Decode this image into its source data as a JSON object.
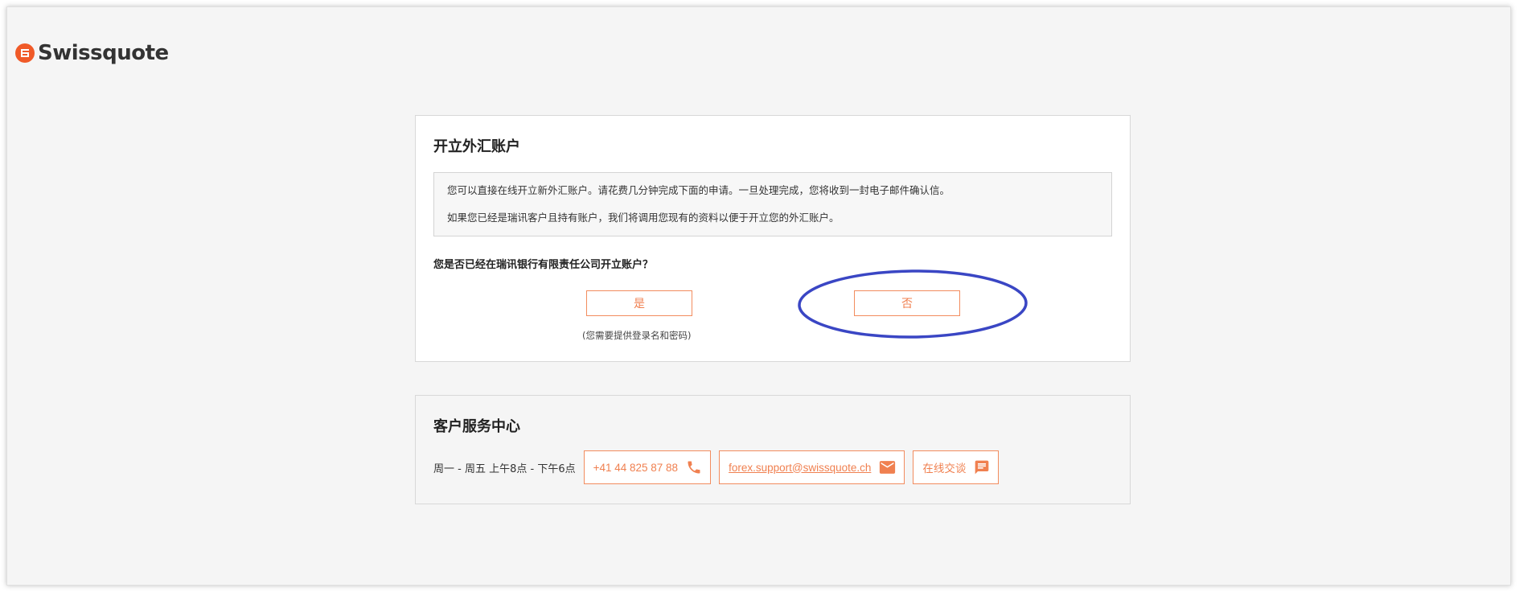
{
  "brand": {
    "name": "Swissquote",
    "accent_color": "#f05a28"
  },
  "open_account": {
    "title": "开立外汇账户",
    "info_line_1": "您可以直接在线开立新外汇账户。请花费几分钟完成下面的申请。一旦处理完成，您将收到一封电子邮件确认信。",
    "info_line_2": "如果您已经是瑞讯客户且持有账户，我们将调用您现有的资料以便于开立您的外汇账户。",
    "question": "您是否已经在瑞讯银行有限责任公司开立账户？",
    "yes_label": "是",
    "no_label": "否",
    "yes_note": "(您需要提供登录名和密码)"
  },
  "service_center": {
    "title": "客户服务中心",
    "hours": "周一 - 周五 上午8点 - 下午6点",
    "phone": "+41 44 825 87 88",
    "email": "forex.support@swissquote.ch",
    "chat_label": "在线交谈"
  },
  "icons": {
    "logo": "swissquote-logo-icon",
    "phone": "phone-icon",
    "email": "email-icon",
    "chat": "chat-icon"
  },
  "annotation_color": "#3a46c4"
}
